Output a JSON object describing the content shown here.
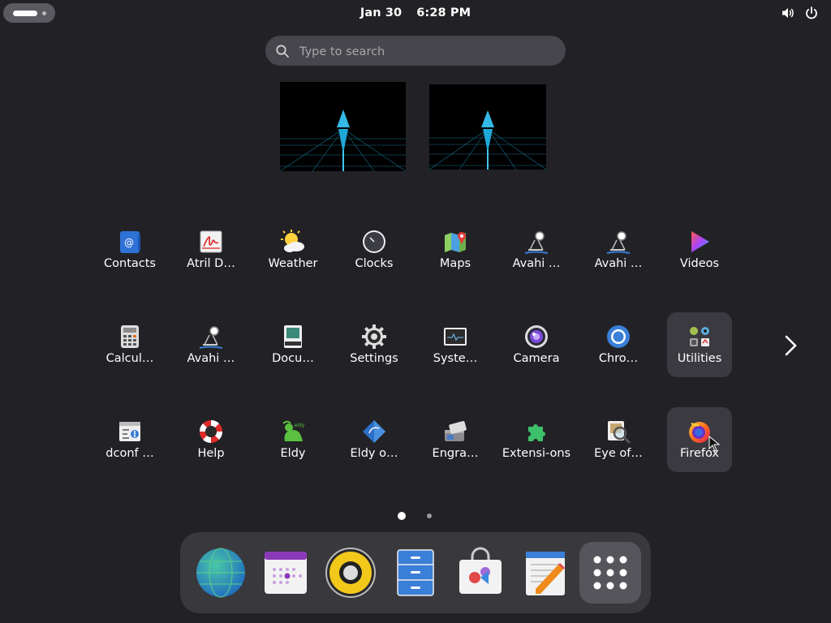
{
  "topbar": {
    "date": "Jan 30",
    "time": "6:28 PM"
  },
  "search": {
    "placeholder": "Type to search"
  },
  "apps": [
    {
      "label": "Contacts",
      "icon": "contacts-icon"
    },
    {
      "label": "Atril D…",
      "icon": "atril-icon"
    },
    {
      "label": "Weather",
      "icon": "weather-icon"
    },
    {
      "label": "Clocks",
      "icon": "clocks-icon"
    },
    {
      "label": "Maps",
      "icon": "maps-icon"
    },
    {
      "label": "Avahi …",
      "icon": "avahi-icon"
    },
    {
      "label": "Avahi …",
      "icon": "avahi-icon"
    },
    {
      "label": "Videos",
      "icon": "videos-icon"
    },
    {
      "label": "Calcul…",
      "icon": "calculator-icon"
    },
    {
      "label": "Avahi …",
      "icon": "avahi-icon"
    },
    {
      "label": "Docu…",
      "icon": "document-scanner-icon"
    },
    {
      "label": "Settings",
      "icon": "settings-icon"
    },
    {
      "label": "Syste…",
      "icon": "system-monitor-icon"
    },
    {
      "label": "Camera",
      "icon": "camera-icon"
    },
    {
      "label": "Chro…",
      "icon": "chromium-icon"
    },
    {
      "label": "Utilities",
      "icon": "utilities-folder-icon"
    },
    {
      "label": "dconf …",
      "icon": "dconf-icon"
    },
    {
      "label": "Help",
      "icon": "help-icon"
    },
    {
      "label": "Eldy",
      "icon": "eldy-icon"
    },
    {
      "label": "Eldy o…",
      "icon": "eldy-online-icon"
    },
    {
      "label": "Engra…",
      "icon": "engrampa-icon"
    },
    {
      "label": "Extensi-ons",
      "icon": "extensions-icon"
    },
    {
      "label": "Eye of…",
      "icon": "eye-of-gnome-icon"
    },
    {
      "label": "Firefox",
      "icon": "firefox-icon"
    }
  ],
  "pages": {
    "current": 1,
    "total": 2
  },
  "dock": [
    {
      "name": "browser-icon"
    },
    {
      "name": "calendar-icon"
    },
    {
      "name": "rhythmbox-icon"
    },
    {
      "name": "files-icon"
    },
    {
      "name": "software-icon"
    },
    {
      "name": "text-editor-icon"
    },
    {
      "name": "show-apps-icon"
    }
  ]
}
